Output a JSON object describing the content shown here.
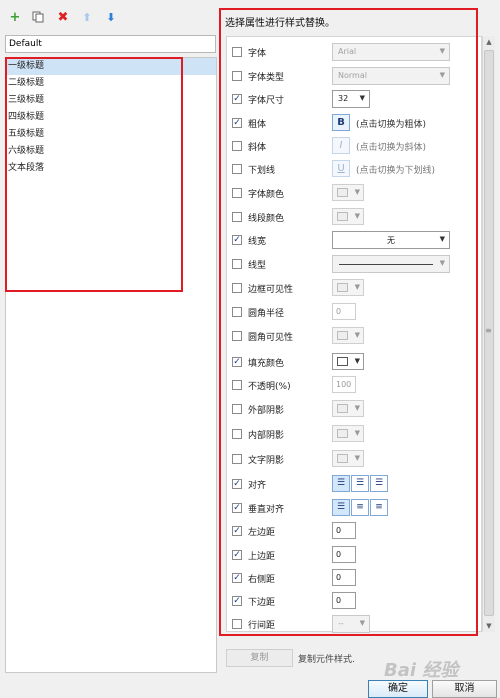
{
  "toolbar": {
    "add_icon": "plus-icon",
    "copy_icon": "duplicate-icon",
    "delete_icon": "delete-x-icon",
    "up_icon": "arrow-up-icon",
    "down_icon": "arrow-down-icon"
  },
  "style_name_value": "Default",
  "style_list": [
    "一级标题",
    "二级标题",
    "三级标题",
    "四级标题",
    "五级标题",
    "六级标题",
    "文本段落"
  ],
  "selected_index": 0,
  "panel_title": "选择属性进行样式替换。",
  "props": {
    "font": {
      "label": "字体",
      "checked": false,
      "value": "Arial"
    },
    "font_type": {
      "label": "字体类型",
      "checked": false,
      "value": "Normal"
    },
    "font_size": {
      "label": "字体尺寸",
      "checked": true,
      "value": "32"
    },
    "bold": {
      "label": "粗体",
      "checked": true,
      "button": "B",
      "hint": "(点击切换为粗体)"
    },
    "italic": {
      "label": "斜体",
      "checked": false,
      "button": "I",
      "hint": "(点击切换为斜体)"
    },
    "underline": {
      "label": "下划线",
      "checked": false,
      "button": "U",
      "hint": "(点击切换为下划线)"
    },
    "font_color": {
      "label": "字体颜色",
      "checked": false
    },
    "line_color": {
      "label": "线段颜色",
      "checked": false
    },
    "line_width": {
      "label": "线宽",
      "checked": true,
      "value": "无"
    },
    "line_type": {
      "label": "线型",
      "checked": false
    },
    "border_visible": {
      "label": "边框可见性",
      "checked": false
    },
    "corner_radius": {
      "label": "圆角半径",
      "checked": false,
      "value": "0"
    },
    "corner_visible": {
      "label": "圆角可见性",
      "checked": false
    },
    "fill_color": {
      "label": "填充颜色",
      "checked": true
    },
    "opacity": {
      "label": "不透明(%)",
      "checked": false,
      "value": "100"
    },
    "outer_shadow": {
      "label": "外部阴影",
      "checked": false
    },
    "inner_shadow": {
      "label": "内部阴影",
      "checked": false
    },
    "text_shadow": {
      "label": "文字阴影",
      "checked": false
    },
    "align": {
      "label": "对齐",
      "checked": true
    },
    "valign": {
      "label": "垂直对齐",
      "checked": true
    },
    "margin_left": {
      "label": "左边距",
      "checked": true,
      "value": "0"
    },
    "margin_top": {
      "label": "上边距",
      "checked": true,
      "value": "0"
    },
    "margin_right": {
      "label": "右侧距",
      "checked": true,
      "value": "0"
    },
    "margin_bottom": {
      "label": "下边距",
      "checked": true,
      "value": "0"
    },
    "line_spacing": {
      "label": "行间距",
      "checked": false,
      "value": "--"
    }
  },
  "copy_button": "复制",
  "copy_hint": "复制元件样式.",
  "ok_button": "确定",
  "cancel_button": "取消",
  "watermark": "Bai 经验",
  "check_glyph": "✓"
}
